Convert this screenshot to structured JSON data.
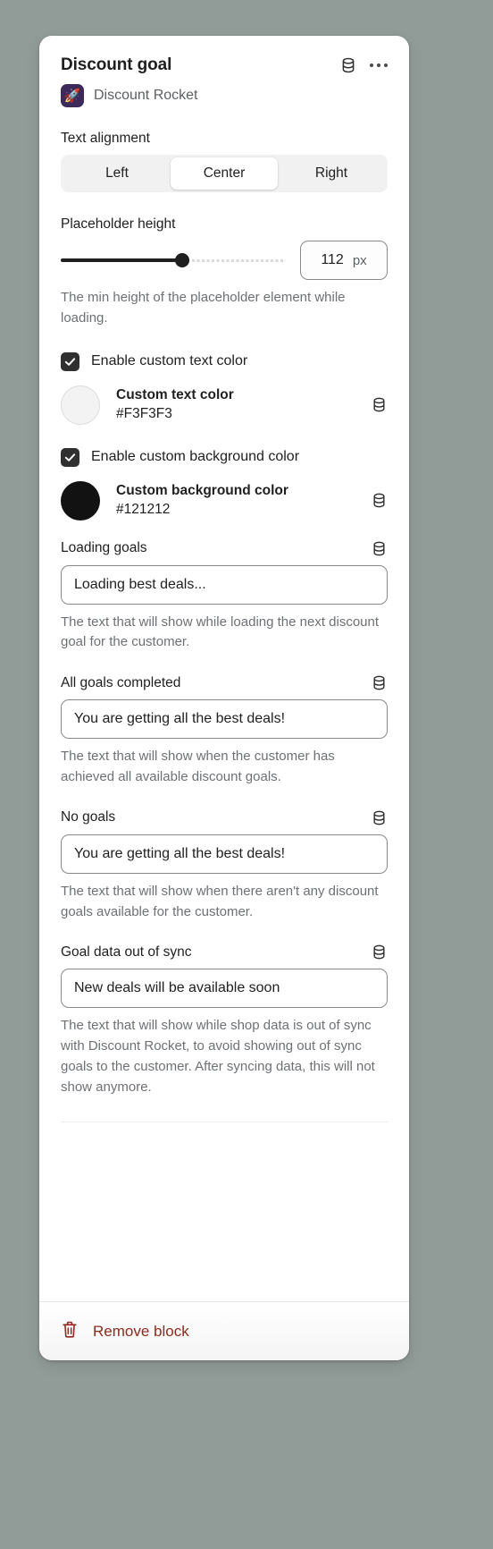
{
  "header": {
    "title": "Discount goal",
    "data_icon": "database-icon",
    "more_icon": "more-actions-icon"
  },
  "app": {
    "icon": "rocket-icon",
    "icon_glyph": "🚀",
    "name": "Discount Rocket",
    "icon_bg": "#3B2A5A"
  },
  "text_alignment": {
    "label": "Text alignment",
    "options": [
      "Left",
      "Center",
      "Right"
    ],
    "selected": "Center"
  },
  "placeholder_height": {
    "label": "Placeholder height",
    "value": "112",
    "unit": "px",
    "fill_percent": 54,
    "help": "The min height of the placeholder element while loading."
  },
  "custom_text_color": {
    "checkbox_label": "Enable custom text color",
    "checked": true,
    "swatch_name": "Custom text color",
    "swatch_hex": "#F3F3F3",
    "data_icon": "database-icon"
  },
  "custom_background_color": {
    "checkbox_label": "Enable custom background color",
    "checked": true,
    "swatch_name": "Custom background color",
    "swatch_hex": "#121212",
    "data_icon": "database-icon"
  },
  "fields": {
    "loading_goals": {
      "label": "Loading goals",
      "value": "Loading best deals...",
      "help": "The text that will show while loading the next discount goal for the customer.",
      "data_icon": "database-icon"
    },
    "all_goals_completed": {
      "label": "All goals completed",
      "value": "You are getting all the best deals!",
      "help": "The text that will show when the customer has achieved all available discount goals.",
      "data_icon": "database-icon"
    },
    "no_goals": {
      "label": "No goals",
      "value": "You are getting all the best deals!",
      "help": "The text that will show when there aren't any discount goals available for the customer.",
      "data_icon": "database-icon"
    },
    "goal_data_out_of_sync": {
      "label": "Goal data out of sync",
      "value": "New deals will be available soon",
      "help": "The text that will show while shop data is out of sync with Discount Rocket, to avoid showing out of sync goals to the customer. After syncing data, this will not show anymore.",
      "data_icon": "database-icon"
    }
  },
  "footer": {
    "remove_label": "Remove block",
    "remove_icon": "trash-icon",
    "remove_color": "#8E2A1C"
  }
}
